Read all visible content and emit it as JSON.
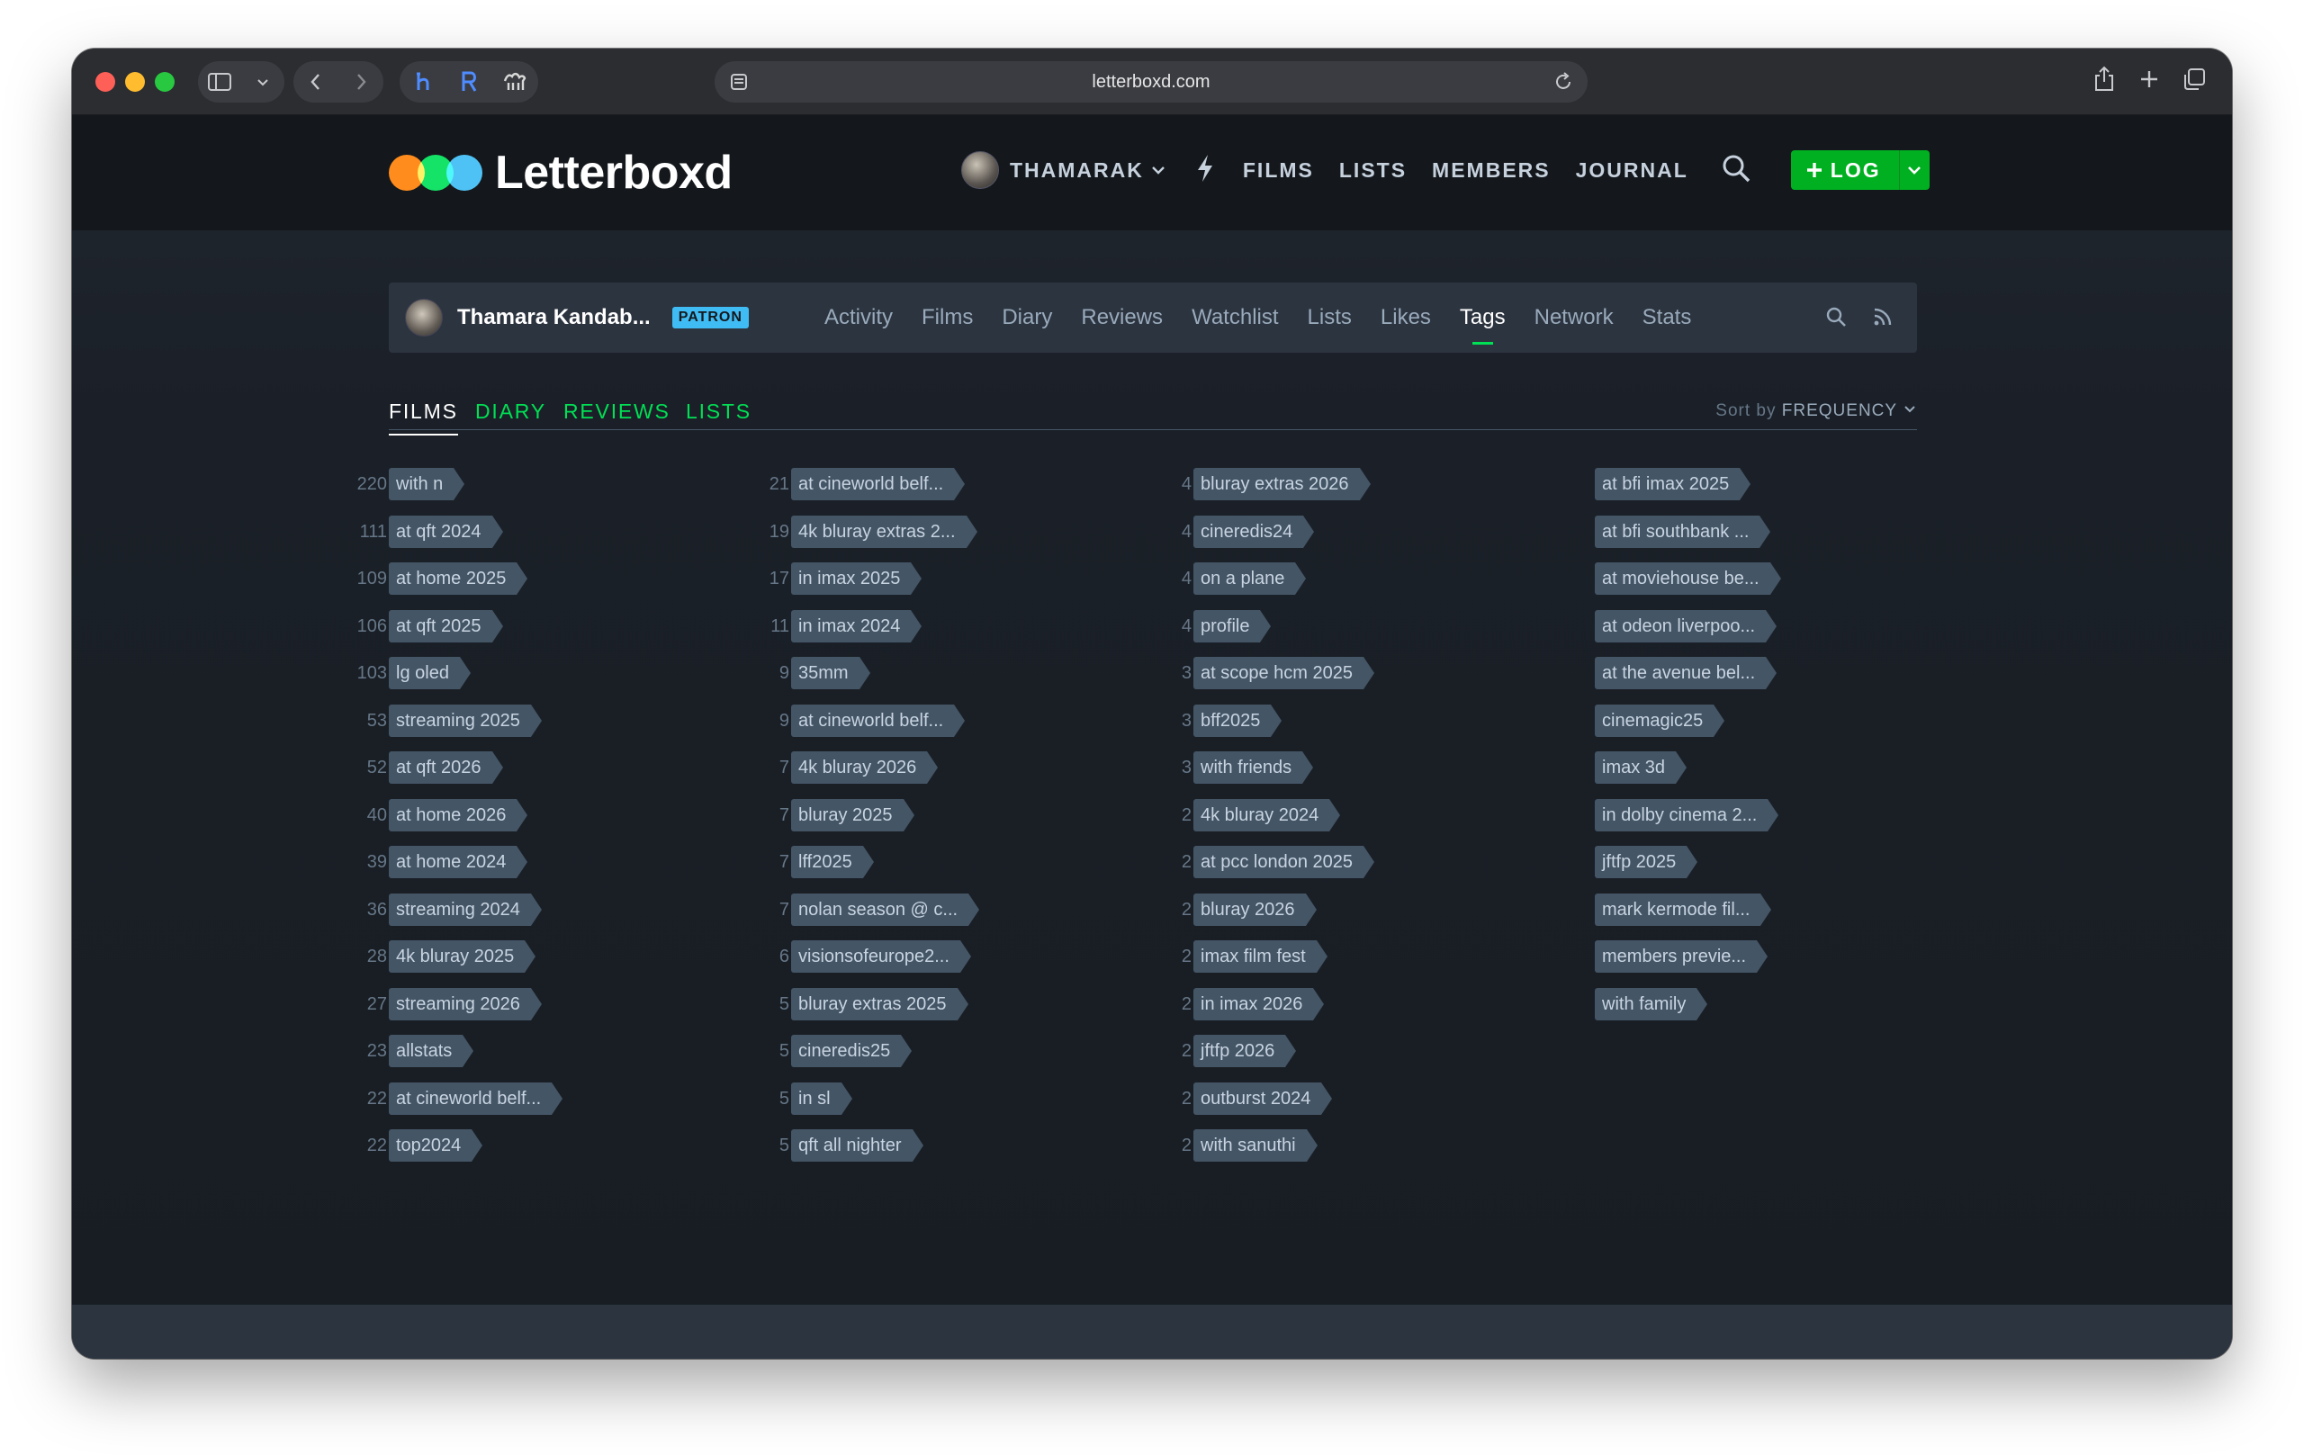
{
  "browser": {
    "url": "letterboxd.com"
  },
  "site": {
    "logo_text": "Letterboxd",
    "nav": {
      "user": "THAMARAK",
      "items": [
        "FILMS",
        "LISTS",
        "MEMBERS",
        "JOURNAL"
      ],
      "log_label": "LOG"
    }
  },
  "profile": {
    "name": "Thamara Kandab...",
    "badge": "PATRON",
    "links": [
      "Activity",
      "Films",
      "Diary",
      "Reviews",
      "Watchlist",
      "Lists",
      "Likes",
      "Tags",
      "Network",
      "Stats"
    ],
    "active_link": "Tags"
  },
  "tabs": {
    "items": [
      "FILMS",
      "DIARY",
      "REVIEWS",
      "LISTS"
    ],
    "active": "FILMS",
    "sort_prefix": "Sort by",
    "sort_value": "FREQUENCY"
  },
  "tag_columns": [
    [
      {
        "tag": "with n",
        "count": "220"
      },
      {
        "tag": "at qft 2024",
        "count": "111"
      },
      {
        "tag": "at home 2025",
        "count": "109"
      },
      {
        "tag": "at qft 2025",
        "count": "106"
      },
      {
        "tag": "lg oled",
        "count": "103"
      },
      {
        "tag": "streaming 2025",
        "count": "53"
      },
      {
        "tag": "at qft 2026",
        "count": "52"
      },
      {
        "tag": "at home 2026",
        "count": "40"
      },
      {
        "tag": "at home 2024",
        "count": "39"
      },
      {
        "tag": "streaming 2024",
        "count": "36"
      },
      {
        "tag": "4k bluray 2025",
        "count": "28"
      },
      {
        "tag": "streaming 2026",
        "count": "27"
      },
      {
        "tag": "allstats",
        "count": "23"
      },
      {
        "tag": "at cineworld belf...",
        "count": "22"
      },
      {
        "tag": "top2024",
        "count": "22"
      }
    ],
    [
      {
        "tag": "at cineworld belf...",
        "count": "21"
      },
      {
        "tag": "4k bluray extras 2...",
        "count": "19"
      },
      {
        "tag": "in imax 2025",
        "count": "17"
      },
      {
        "tag": "in imax 2024",
        "count": "11"
      },
      {
        "tag": "35mm",
        "count": "9"
      },
      {
        "tag": "at cineworld belf...",
        "count": "9"
      },
      {
        "tag": "4k bluray 2026",
        "count": "7"
      },
      {
        "tag": "bluray 2025",
        "count": "7"
      },
      {
        "tag": "lff2025",
        "count": "7"
      },
      {
        "tag": "nolan season @ c...",
        "count": "7"
      },
      {
        "tag": "visionsofeurope2...",
        "count": "6"
      },
      {
        "tag": "bluray extras 2025",
        "count": "5"
      },
      {
        "tag": "cineredis25",
        "count": "5"
      },
      {
        "tag": "in sl",
        "count": "5"
      },
      {
        "tag": "qft all nighter",
        "count": "5"
      }
    ],
    [
      {
        "tag": "bluray extras 2026",
        "count": "4"
      },
      {
        "tag": "cineredis24",
        "count": "4"
      },
      {
        "tag": "on a plane",
        "count": "4"
      },
      {
        "tag": "profile",
        "count": "4"
      },
      {
        "tag": "at scope hcm 2025",
        "count": "3"
      },
      {
        "tag": "bff2025",
        "count": "3"
      },
      {
        "tag": "with friends",
        "count": "3"
      },
      {
        "tag": "4k bluray 2024",
        "count": "2"
      },
      {
        "tag": "at pcc london 2025",
        "count": "2"
      },
      {
        "tag": "bluray 2026",
        "count": "2"
      },
      {
        "tag": "imax film fest",
        "count": "2"
      },
      {
        "tag": "in imax 2026",
        "count": "2"
      },
      {
        "tag": "jftfp 2026",
        "count": "2"
      },
      {
        "tag": "outburst 2024",
        "count": "2"
      },
      {
        "tag": "with sanuthi",
        "count": "2"
      }
    ],
    [
      {
        "tag": "at bfi imax 2025",
        "count": ""
      },
      {
        "tag": "at bfi southbank ...",
        "count": ""
      },
      {
        "tag": "at moviehouse be...",
        "count": ""
      },
      {
        "tag": "at odeon liverpoo...",
        "count": ""
      },
      {
        "tag": "at the avenue bel...",
        "count": ""
      },
      {
        "tag": "cinemagic25",
        "count": ""
      },
      {
        "tag": "imax 3d",
        "count": ""
      },
      {
        "tag": "in dolby cinema 2...",
        "count": ""
      },
      {
        "tag": "jftfp 2025",
        "count": ""
      },
      {
        "tag": "mark kermode fil...",
        "count": ""
      },
      {
        "tag": "members previe...",
        "count": ""
      },
      {
        "tag": "with family",
        "count": ""
      }
    ]
  ],
  "colors": {
    "bg": "#14181c",
    "tag_bg": "#445566",
    "accent_green": "#00e054",
    "accent_blue": "#40bcf4",
    "accent_orange": "#ff8000"
  }
}
